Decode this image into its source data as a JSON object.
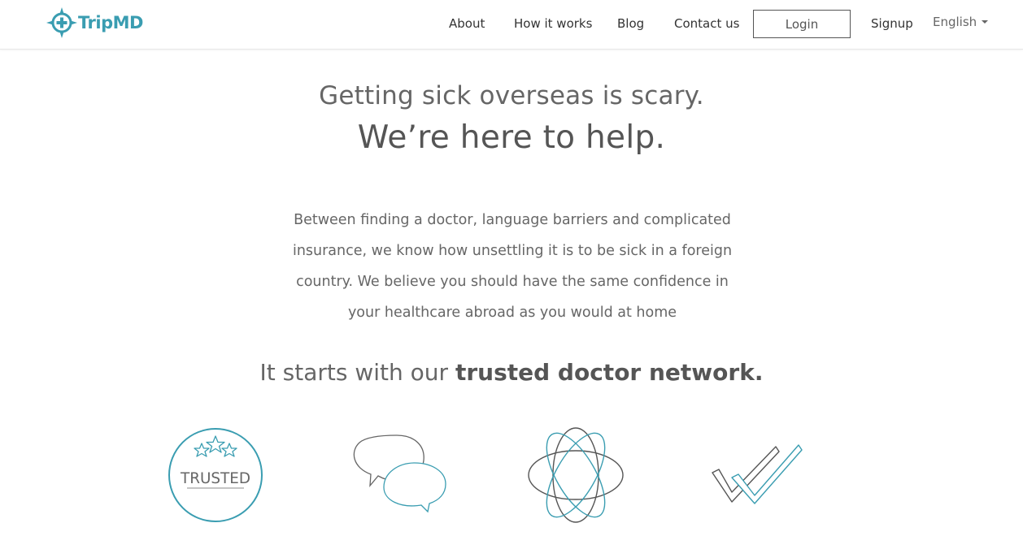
{
  "brand": {
    "name_trip": "Trip",
    "name_md": "MD",
    "logo_icon": "compass-cross-icon",
    "primary_color": "#3a9db1",
    "text_color": "#555555"
  },
  "nav": {
    "about": "About",
    "how_it_works": "How it works",
    "blog": "Blog",
    "contact": "Contact us",
    "login": "Login",
    "signup": "Signup",
    "language": "English"
  },
  "hero": {
    "line1": "Getting sick overseas is scary.",
    "line2": "We’re here to help."
  },
  "intro": {
    "text": "Between finding a doctor, language barriers and complicated insurance, we know how unsettling it is to be sick in a foreign country. We believe you should have the same confidence in your healthcare abroad as you would at home"
  },
  "tagline": {
    "prefix": "It starts with our ",
    "bold": "trusted doctor network",
    "suffix": "."
  },
  "features": {
    "trusted_badge_text": "TRUSTED",
    "icons": [
      "trusted-badge-icon",
      "speech-bubbles-icon",
      "atom-icon",
      "double-check-icon"
    ]
  }
}
